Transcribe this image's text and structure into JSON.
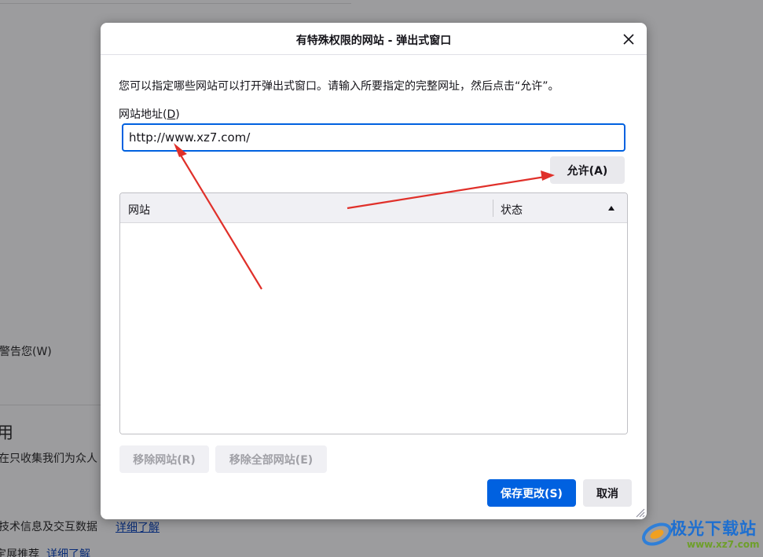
{
  "background": {
    "partial_text_1": "警告您(W)",
    "partial_heading": "用",
    "partial_text_2": "在只收集我们为众人",
    "partial_text_3": "技术信息及交互数据",
    "link_1": "详细了解",
    "partial_text_4": "定展推荐",
    "link_2": "详细了解"
  },
  "dialog": {
    "title": "有特殊权限的网站 - 弹出式窗口",
    "close_icon": "close-icon",
    "description": "您可以指定哪些网站可以打开弹出式窗口。请输入所要指定的完整网址，然后点击“允许”。",
    "address_label": "网站地址(",
    "address_label_key": "D",
    "address_label_end": ")",
    "address_value": "http://www.xz7.com/",
    "allow_button": "允许(A)",
    "table": {
      "columns": [
        "网站",
        "状态"
      ],
      "rows": []
    },
    "remove_button": "移除网站(R)",
    "remove_all_button": "移除全部网站(E)",
    "save_button": "保存更改(S)",
    "cancel_button": "取消"
  },
  "colors": {
    "accent": "#0061e0",
    "annotation": "#e0302a"
  },
  "watermark": {
    "text": "极光下载站",
    "url": "www.xz7.com"
  }
}
